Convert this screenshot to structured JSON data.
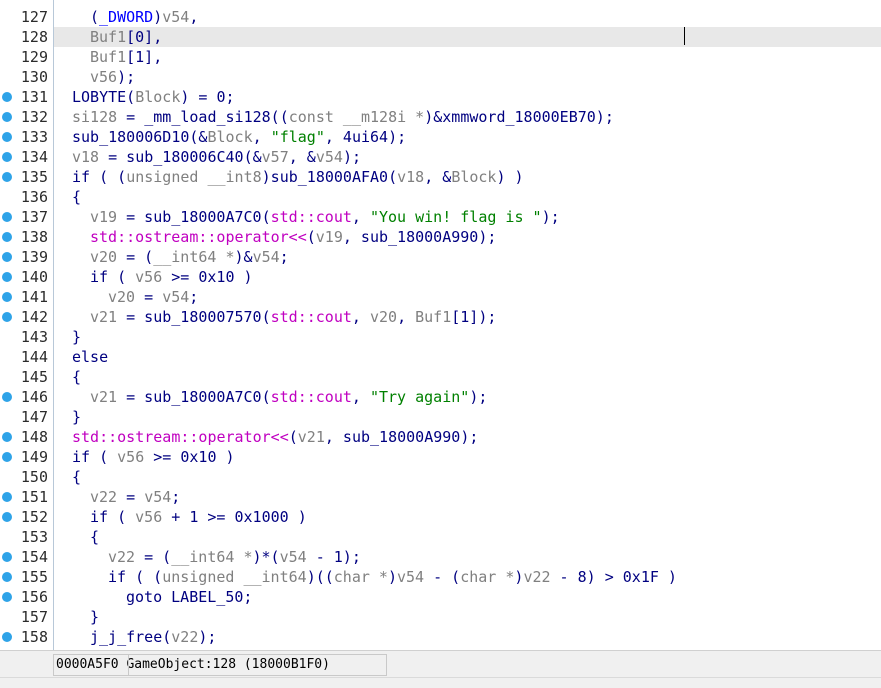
{
  "editor": {
    "highlighted_line": "128",
    "lines": [
      {
        "num": "127",
        "bp": false,
        "indent": 4,
        "tokens": [
          [
            "plain",
            "("
          ],
          [
            "glob",
            "_DWORD"
          ],
          [
            "plain",
            ")"
          ],
          [
            "var",
            "v54"
          ],
          [
            "plain",
            ","
          ]
        ]
      },
      {
        "num": "128",
        "bp": false,
        "indent": 4,
        "tokens": [
          [
            "var",
            "Buf1"
          ],
          [
            "plain",
            "[0],"
          ]
        ]
      },
      {
        "num": "129",
        "bp": false,
        "indent": 4,
        "tokens": [
          [
            "var",
            "Buf1"
          ],
          [
            "plain",
            "[1],"
          ]
        ]
      },
      {
        "num": "130",
        "bp": false,
        "indent": 4,
        "tokens": [
          [
            "var",
            "v56"
          ],
          [
            "plain",
            ");"
          ]
        ]
      },
      {
        "num": "131",
        "bp": true,
        "indent": 2,
        "tokens": [
          [
            "plain",
            "LOBYTE("
          ],
          [
            "var",
            "Block"
          ],
          [
            "plain",
            ") = 0;"
          ]
        ]
      },
      {
        "num": "132",
        "bp": true,
        "indent": 2,
        "tokens": [
          [
            "var",
            "si128"
          ],
          [
            "plain",
            " = _mm_load_si128(("
          ],
          [
            "var",
            "const __m128i *"
          ],
          [
            "plain",
            ")&xmmword_18000EB70);"
          ]
        ]
      },
      {
        "num": "133",
        "bp": true,
        "indent": 2,
        "tokens": [
          [
            "plain",
            "sub_180006D10(&"
          ],
          [
            "var",
            "Block"
          ],
          [
            "plain",
            ", "
          ],
          [
            "str",
            "\"flag\""
          ],
          [
            "plain",
            ", 4ui64);"
          ]
        ]
      },
      {
        "num": "134",
        "bp": true,
        "indent": 2,
        "tokens": [
          [
            "var",
            "v18"
          ],
          [
            "plain",
            " = sub_180006C40(&"
          ],
          [
            "var",
            "v57"
          ],
          [
            "plain",
            ", &"
          ],
          [
            "var",
            "v54"
          ],
          [
            "plain",
            ");"
          ]
        ]
      },
      {
        "num": "135",
        "bp": true,
        "indent": 2,
        "tokens": [
          [
            "plain",
            "if ( ("
          ],
          [
            "var",
            "unsigned __int8"
          ],
          [
            "plain",
            ")sub_18000AFA0("
          ],
          [
            "var",
            "v18"
          ],
          [
            "plain",
            ", &"
          ],
          [
            "var",
            "Block"
          ],
          [
            "plain",
            ") )"
          ]
        ]
      },
      {
        "num": "136",
        "bp": false,
        "indent": 2,
        "tokens": [
          [
            "plain",
            "{"
          ]
        ]
      },
      {
        "num": "137",
        "bp": true,
        "indent": 4,
        "tokens": [
          [
            "var",
            "v19"
          ],
          [
            "plain",
            " = sub_18000A7C0("
          ],
          [
            "std",
            "std::cout"
          ],
          [
            "plain",
            ", "
          ],
          [
            "str",
            "\"You win! flag is \""
          ],
          [
            "plain",
            ");"
          ]
        ]
      },
      {
        "num": "138",
        "bp": true,
        "indent": 4,
        "tokens": [
          [
            "std",
            "std::ostream::operator<<"
          ],
          [
            "plain",
            "("
          ],
          [
            "var",
            "v19"
          ],
          [
            "plain",
            ", sub_18000A990);"
          ]
        ]
      },
      {
        "num": "139",
        "bp": true,
        "indent": 4,
        "tokens": [
          [
            "var",
            "v20"
          ],
          [
            "plain",
            " = ("
          ],
          [
            "var",
            "__int64 *"
          ],
          [
            "plain",
            ")&"
          ],
          [
            "var",
            "v54"
          ],
          [
            "plain",
            ";"
          ]
        ]
      },
      {
        "num": "140",
        "bp": true,
        "indent": 4,
        "tokens": [
          [
            "plain",
            "if ( "
          ],
          [
            "var",
            "v56"
          ],
          [
            "plain",
            " >= 0x10 )"
          ]
        ]
      },
      {
        "num": "141",
        "bp": true,
        "indent": 6,
        "tokens": [
          [
            "var",
            "v20"
          ],
          [
            "plain",
            " = "
          ],
          [
            "var",
            "v54"
          ],
          [
            "plain",
            ";"
          ]
        ]
      },
      {
        "num": "142",
        "bp": true,
        "indent": 4,
        "tokens": [
          [
            "var",
            "v21"
          ],
          [
            "plain",
            " = sub_180007570("
          ],
          [
            "std",
            "std::cout"
          ],
          [
            "plain",
            ", "
          ],
          [
            "var",
            "v20"
          ],
          [
            "plain",
            ", "
          ],
          [
            "var",
            "Buf1"
          ],
          [
            "plain",
            "[1]);"
          ]
        ]
      },
      {
        "num": "143",
        "bp": false,
        "indent": 2,
        "tokens": [
          [
            "plain",
            "}"
          ]
        ]
      },
      {
        "num": "144",
        "bp": false,
        "indent": 2,
        "tokens": [
          [
            "plain",
            "else"
          ]
        ]
      },
      {
        "num": "145",
        "bp": false,
        "indent": 2,
        "tokens": [
          [
            "plain",
            "{"
          ]
        ]
      },
      {
        "num": "146",
        "bp": true,
        "indent": 4,
        "tokens": [
          [
            "var",
            "v21"
          ],
          [
            "plain",
            " = sub_18000A7C0("
          ],
          [
            "std",
            "std::cout"
          ],
          [
            "plain",
            ", "
          ],
          [
            "str",
            "\"Try again\""
          ],
          [
            "plain",
            ");"
          ]
        ]
      },
      {
        "num": "147",
        "bp": false,
        "indent": 2,
        "tokens": [
          [
            "plain",
            "}"
          ]
        ]
      },
      {
        "num": "148",
        "bp": true,
        "indent": 2,
        "tokens": [
          [
            "std",
            "std::ostream::operator<<"
          ],
          [
            "plain",
            "("
          ],
          [
            "var",
            "v21"
          ],
          [
            "plain",
            ", sub_18000A990);"
          ]
        ]
      },
      {
        "num": "149",
        "bp": true,
        "indent": 2,
        "tokens": [
          [
            "plain",
            "if ( "
          ],
          [
            "var",
            "v56"
          ],
          [
            "plain",
            " >= 0x10 )"
          ]
        ]
      },
      {
        "num": "150",
        "bp": false,
        "indent": 2,
        "tokens": [
          [
            "plain",
            "{"
          ]
        ]
      },
      {
        "num": "151",
        "bp": true,
        "indent": 4,
        "tokens": [
          [
            "var",
            "v22"
          ],
          [
            "plain",
            " = "
          ],
          [
            "var",
            "v54"
          ],
          [
            "plain",
            ";"
          ]
        ]
      },
      {
        "num": "152",
        "bp": true,
        "indent": 4,
        "tokens": [
          [
            "plain",
            "if ( "
          ],
          [
            "var",
            "v56"
          ],
          [
            "plain",
            " + 1 >= 0x1000 )"
          ]
        ]
      },
      {
        "num": "153",
        "bp": false,
        "indent": 4,
        "tokens": [
          [
            "plain",
            "{"
          ]
        ]
      },
      {
        "num": "154",
        "bp": true,
        "indent": 6,
        "tokens": [
          [
            "var",
            "v22"
          ],
          [
            "plain",
            " = ("
          ],
          [
            "var",
            "__int64 *"
          ],
          [
            "plain",
            ")*("
          ],
          [
            "var",
            "v54"
          ],
          [
            "plain",
            " - 1);"
          ]
        ]
      },
      {
        "num": "155",
        "bp": true,
        "indent": 6,
        "tokens": [
          [
            "plain",
            "if ( ("
          ],
          [
            "var",
            "unsigned __int64"
          ],
          [
            "plain",
            ")(("
          ],
          [
            "var",
            "char *"
          ],
          [
            "plain",
            ")"
          ],
          [
            "var",
            "v54"
          ],
          [
            "plain",
            " - ("
          ],
          [
            "var",
            "char *"
          ],
          [
            "plain",
            ")"
          ],
          [
            "var",
            "v22"
          ],
          [
            "plain",
            " - 8) > 0x1F )"
          ]
        ]
      },
      {
        "num": "156",
        "bp": true,
        "indent": 8,
        "tokens": [
          [
            "plain",
            "goto LABEL_50;"
          ]
        ]
      },
      {
        "num": "157",
        "bp": false,
        "indent": 4,
        "tokens": [
          [
            "plain",
            "}"
          ]
        ]
      },
      {
        "num": "158",
        "bp": true,
        "indent": 4,
        "tokens": [
          [
            "plain",
            "j_j_free("
          ],
          [
            "var",
            "v22"
          ],
          [
            "plain",
            ");"
          ]
        ]
      }
    ]
  },
  "status": {
    "offset": "0000A5F0",
    "location": "GameObject:128 (18000B1F0)"
  },
  "colors": {
    "plain": "#000080",
    "var": "#808080",
    "std": "#c000c0",
    "str": "#008000",
    "glob": "#0000ff",
    "breakpoint": "#2ea3e8",
    "highlight": "#e8e8e8"
  }
}
